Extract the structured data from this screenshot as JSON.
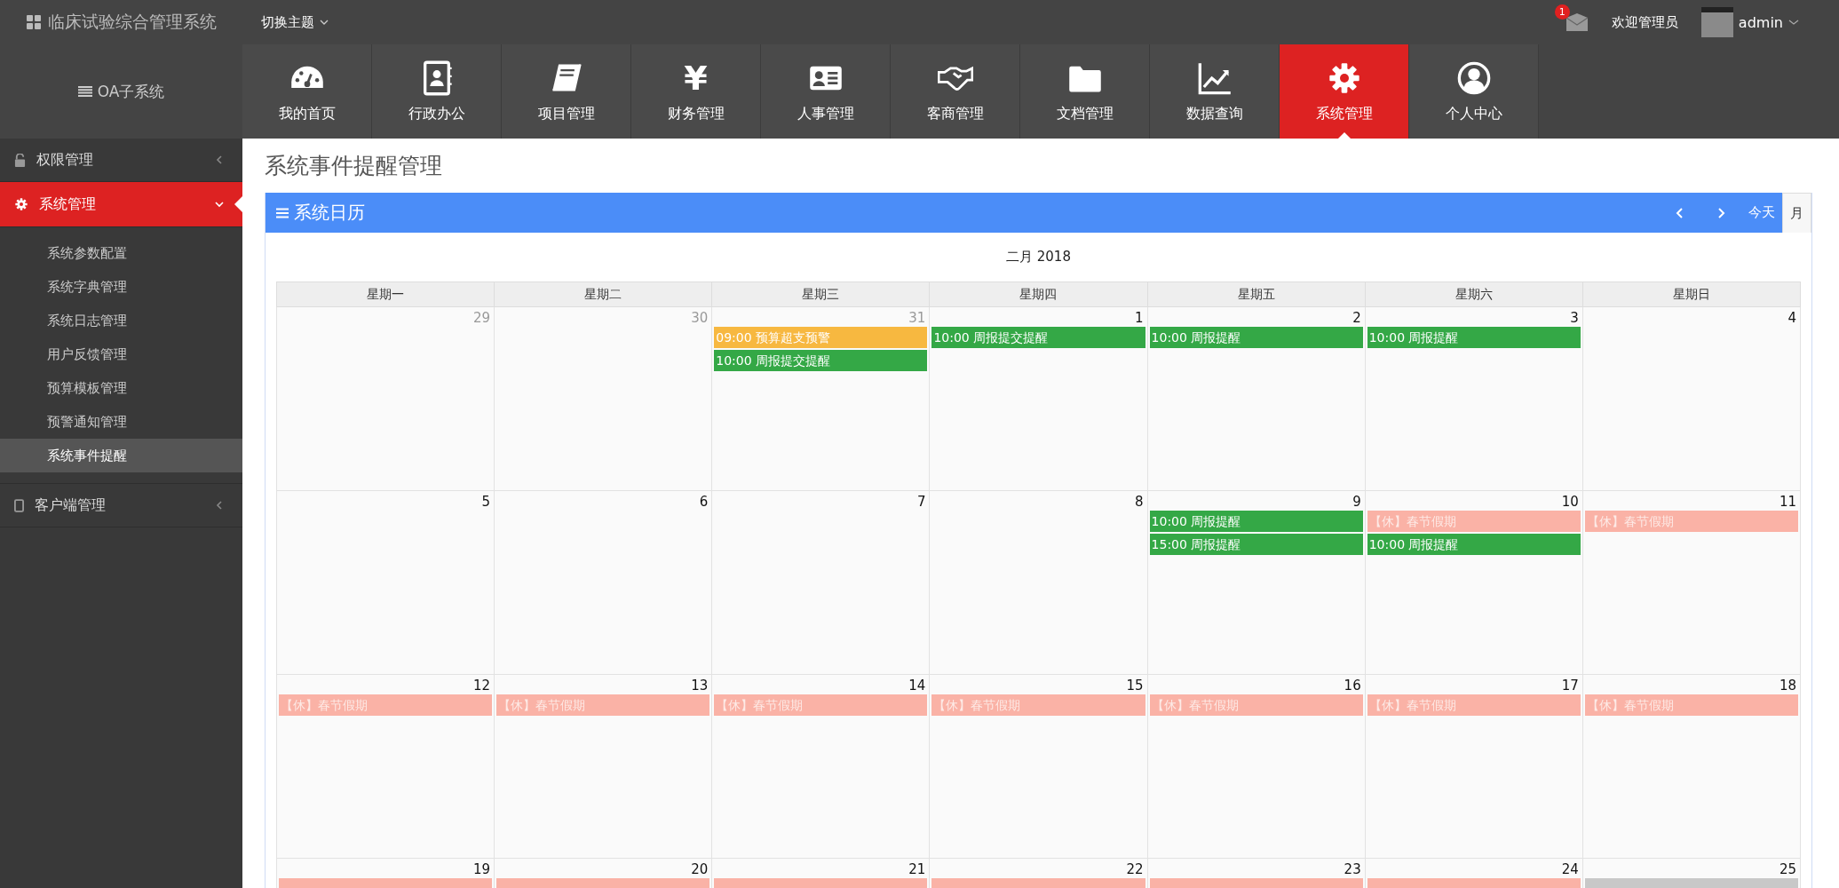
{
  "app_title": "临床试验综合管理系统",
  "theme_switch": {
    "label": "切换主题",
    "expanded": false
  },
  "user": {
    "notification_count": "1",
    "welcome": "欢迎管理员",
    "name": "admin"
  },
  "subsystem": "OA子系统",
  "modules": [
    {
      "label": "我的首页",
      "selected": false
    },
    {
      "label": "行政办公",
      "selected": false
    },
    {
      "label": "项目管理",
      "selected": false
    },
    {
      "label": "财务管理",
      "selected": false,
      "glyph": "¥"
    },
    {
      "label": "人事管理",
      "selected": false
    },
    {
      "label": "客商管理",
      "selected": false
    },
    {
      "label": "文档管理",
      "selected": false
    },
    {
      "label": "数据查询",
      "selected": false
    },
    {
      "label": "系统管理",
      "selected": true
    },
    {
      "label": "个人中心",
      "selected": false
    }
  ],
  "sidebar": {
    "items": [
      {
        "label": "权限管理",
        "expanded": false,
        "selected": false
      },
      {
        "label": "系统管理",
        "expanded": true,
        "selected": true,
        "children": [
          {
            "label": "系统参数配置",
            "selected": false
          },
          {
            "label": "系统字典管理",
            "selected": false
          },
          {
            "label": "系统日志管理",
            "selected": false
          },
          {
            "label": "用户反馈管理",
            "selected": false
          },
          {
            "label": "预算模板管理",
            "selected": false
          },
          {
            "label": "预警通知管理",
            "selected": false
          },
          {
            "label": "系统事件提醒",
            "selected": true
          }
        ]
      },
      {
        "label": "客户端管理",
        "expanded": false,
        "selected": false
      }
    ]
  },
  "page_title": "系统事件提醒管理",
  "calendar": {
    "title": "系统日历",
    "views": [
      {
        "label": "今天",
        "selected": false
      },
      {
        "label": "月",
        "selected": true
      }
    ],
    "month_title": "二月 2018",
    "weekdays": [
      "星期一",
      "星期二",
      "星期三",
      "星期四",
      "星期五",
      "星期六",
      "星期日"
    ],
    "weeks": [
      [
        {
          "day": "29",
          "other_month": true
        },
        {
          "day": "30",
          "other_month": true
        },
        {
          "day": "31",
          "other_month": true,
          "events": [
            {
              "kind": "warning",
              "label": "09:00 预算超支预警"
            },
            {
              "kind": "reminder",
              "label": "10:00 周报提交提醒"
            }
          ]
        },
        {
          "day": "1",
          "other_month": false,
          "events": [
            {
              "kind": "reminder",
              "label": "10:00 周报提交提醒"
            }
          ]
        },
        {
          "day": "2",
          "other_month": false,
          "events": [
            {
              "kind": "reminder",
              "label": "10:00 周报提醒"
            }
          ]
        },
        {
          "day": "3",
          "other_month": false,
          "events": [
            {
              "kind": "reminder",
              "label": "10:00 周报提醒"
            }
          ]
        },
        {
          "day": "4",
          "other_month": false
        }
      ],
      [
        {
          "day": "5",
          "other_month": false
        },
        {
          "day": "6",
          "other_month": false
        },
        {
          "day": "7",
          "other_month": false
        },
        {
          "day": "8",
          "other_month": false
        },
        {
          "day": "9",
          "other_month": false,
          "events": [
            {
              "kind": "reminder",
              "label": "10:00 周报提醒"
            },
            {
              "kind": "reminder",
              "label": "15:00 周报提醒"
            }
          ]
        },
        {
          "day": "10",
          "other_month": false,
          "events": [
            {
              "kind": "holiday",
              "label": "【休】春节假期"
            },
            {
              "kind": "reminder",
              "label": "10:00 周报提醒"
            }
          ]
        },
        {
          "day": "11",
          "other_month": false,
          "events": [
            {
              "kind": "holiday",
              "label": "【休】春节假期"
            }
          ]
        }
      ],
      [
        {
          "day": "12",
          "other_month": false,
          "events": [
            {
              "kind": "holiday",
              "label": "【休】春节假期"
            }
          ]
        },
        {
          "day": "13",
          "other_month": false,
          "events": [
            {
              "kind": "holiday",
              "label": "【休】春节假期"
            }
          ]
        },
        {
          "day": "14",
          "other_month": false,
          "events": [
            {
              "kind": "holiday",
              "label": "【休】春节假期"
            }
          ]
        },
        {
          "day": "15",
          "other_month": false,
          "events": [
            {
              "kind": "holiday",
              "label": "【休】春节假期"
            }
          ]
        },
        {
          "day": "16",
          "other_month": false,
          "events": [
            {
              "kind": "holiday",
              "label": "【休】春节假期"
            }
          ]
        },
        {
          "day": "17",
          "other_month": false,
          "events": [
            {
              "kind": "holiday",
              "label": "【休】春节假期"
            }
          ]
        },
        {
          "day": "18",
          "other_month": false,
          "events": [
            {
              "kind": "holiday",
              "label": "【休】春节假期"
            }
          ]
        }
      ],
      [
        {
          "day": "19",
          "other_month": false,
          "events": [
            {
              "kind": "holiday"
            }
          ]
        },
        {
          "day": "20",
          "other_month": false,
          "events": [
            {
              "kind": "holiday"
            }
          ]
        },
        {
          "day": "21",
          "other_month": false,
          "events": [
            {
              "kind": "holiday"
            }
          ]
        },
        {
          "day": "22",
          "other_month": false,
          "events": [
            {
              "kind": "holiday"
            }
          ]
        },
        {
          "day": "23",
          "other_month": false,
          "events": [
            {
              "kind": "holiday"
            }
          ]
        },
        {
          "day": "24",
          "other_month": false,
          "events": [
            {
              "kind": "holiday"
            }
          ]
        },
        {
          "day": "25",
          "other_month": false,
          "events": [
            {
              "kind": "other"
            }
          ]
        }
      ]
    ]
  }
}
